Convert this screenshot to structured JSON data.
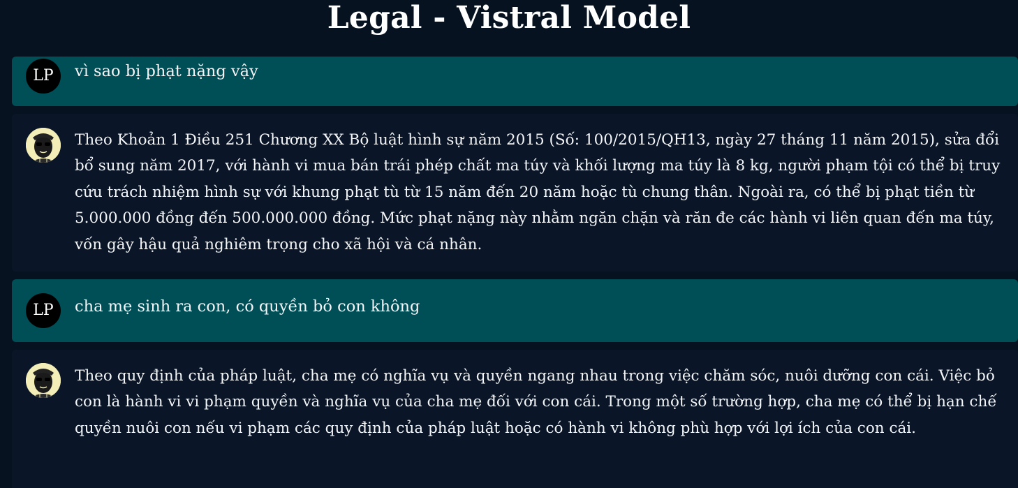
{
  "app": {
    "title": "Legal - Vistral Model"
  },
  "messages": [
    {
      "role": "user",
      "avatar": "LP",
      "text": "vì sao bị phạt nặng vậy"
    },
    {
      "role": "assistant",
      "avatar_icon": "bot-avatar-icon",
      "text": "Theo Khoản 1 Điều 251 Chương XX Bộ luật hình sự năm 2015 (Số: 100/2015/QH13, ngày 27 tháng 11 năm 2015), sửa đổi bổ sung năm 2017, với hành vi mua bán trái phép chất ma túy và khối lượng ma túy là 8 kg, người phạm tội có thể bị truy cứu trách nhiệm hình sự với khung phạt tù từ 15 năm đến 20 năm hoặc tù chung thân. Ngoài ra, có thể bị phạt tiền từ 5.000.000 đồng đến 500.000.000 đồng. Mức phạt nặng này nhằm ngăn chặn và răn đe các hành vi liên quan đến ma túy, vốn gây hậu quả nghiêm trọng cho xã hội và cá nhân."
    },
    {
      "role": "user",
      "avatar": "LP",
      "text": "cha mẹ sinh ra con, có quyền bỏ con không"
    },
    {
      "role": "assistant",
      "avatar_icon": "bot-avatar-icon",
      "text": "Theo quy định của pháp luật, cha mẹ có nghĩa vụ và quyền ngang nhau trong việc chăm sóc, nuôi dưỡng con cái. Việc bỏ con là hành vi vi phạm quyền và nghĩa vụ của cha mẹ đối với con cái. Trong một số trường hợp, cha mẹ có thể bị hạn chế quyền nuôi con nếu vi phạm các quy định của pháp luật hoặc có hành vi không phù hợp với lợi ích của con cái."
    }
  ],
  "colors": {
    "background": "#061220",
    "user_bubble": "#004e56",
    "assistant_bubble": "#0a1628",
    "text": "#f3f5f7",
    "user_avatar_bg": "#000000",
    "bot_avatar_bg": "#f3edb7"
  }
}
